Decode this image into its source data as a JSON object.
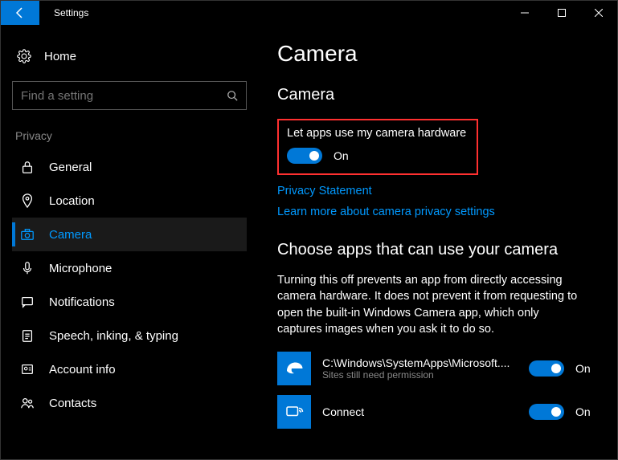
{
  "window": {
    "title": "Settings"
  },
  "sidebar": {
    "home": "Home",
    "search_placeholder": "Find a setting",
    "section": "Privacy",
    "items": [
      {
        "label": "General"
      },
      {
        "label": "Location"
      },
      {
        "label": "Camera"
      },
      {
        "label": "Microphone"
      },
      {
        "label": "Notifications"
      },
      {
        "label": "Speech, inking, & typing"
      },
      {
        "label": "Account info"
      },
      {
        "label": "Contacts"
      }
    ]
  },
  "content": {
    "title": "Camera",
    "subtitle": "Camera",
    "hardware_label": "Let apps use my camera hardware",
    "hardware_state": "On",
    "privacy_link": "Privacy Statement",
    "learn_link": "Learn more about camera privacy settings",
    "choose_heading": "Choose apps that can use your camera",
    "choose_desc": "Turning this off prevents an app from directly accessing camera hardware. It does not prevent it from requesting to open the built-in Windows Camera app, which only captures images when you ask it to do so.",
    "apps": [
      {
        "name": "C:\\Windows\\SystemApps\\Microsoft....",
        "sub": "Sites still need permission",
        "state": "On"
      },
      {
        "name": "Connect",
        "sub": "",
        "state": "On"
      }
    ]
  }
}
